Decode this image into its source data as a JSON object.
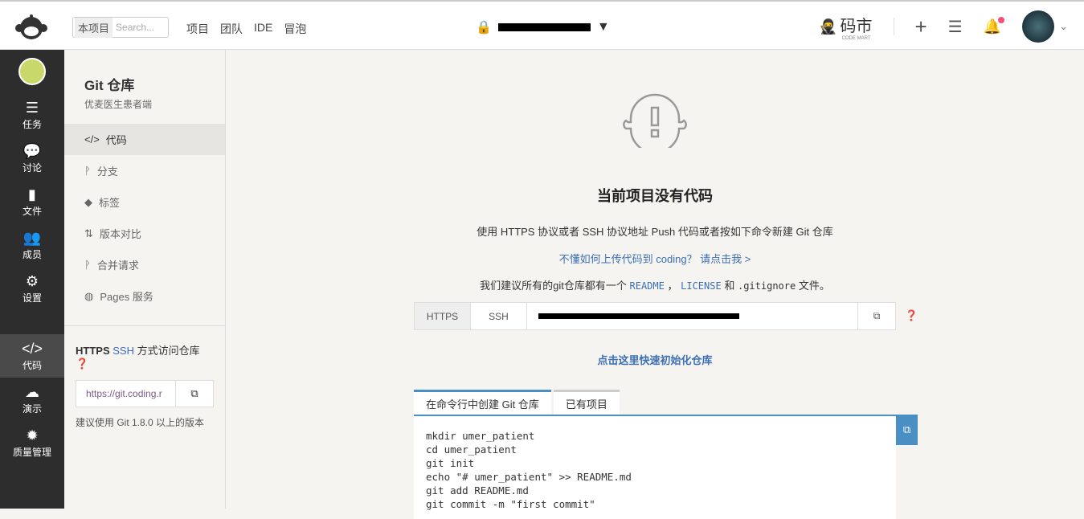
{
  "header": {
    "search_scope": "本项目",
    "search_placeholder": "Search...",
    "nav": [
      "项目",
      "团队",
      "IDE",
      "冒泡"
    ],
    "brand": "码市",
    "brand_sub": "CODE MART"
  },
  "sidebar": [
    {
      "label": "任务",
      "icon": "tasks-icon"
    },
    {
      "label": "讨论",
      "icon": "comments-icon"
    },
    {
      "label": "文件",
      "icon": "file-icon"
    },
    {
      "label": "成员",
      "icon": "users-icon"
    },
    {
      "label": "设置",
      "icon": "gear-icon"
    },
    {
      "label": "代码",
      "icon": "code-icon"
    },
    {
      "label": "演示",
      "icon": "cloud-icon"
    },
    {
      "label": "质量管理",
      "icon": "quality-icon"
    }
  ],
  "subnav": {
    "title": "Git 仓库",
    "desc": "优麦医生患者端",
    "items": [
      {
        "label": "代码",
        "icon": "</>"
      },
      {
        "label": "分支",
        "icon": "ᚹ"
      },
      {
        "label": "标签",
        "icon": "◆"
      },
      {
        "label": "版本对比",
        "icon": "⇅"
      },
      {
        "label": "合并请求",
        "icon": "ᚹ"
      },
      {
        "label": "Pages 服务",
        "icon": "◍"
      }
    ],
    "access_title_a": "HTTPS",
    "access_title_b": "SSH",
    "access_title_c": "方式访问仓库",
    "url": "https://git.coding.r",
    "hint": "建议使用 Git 1.8.0 以上的版本"
  },
  "main": {
    "title": "当前项目没有代码",
    "line1": "使用 HTTPS 协议或者 SSH 协议地址 Push 代码或者按如下命令新建 Git 仓库",
    "help_link": "不懂如何上传代码到 coding？ 请点击我 >",
    "line3a": "我们建议所有的git仓库都有一个",
    "readme": "README",
    "comma": "，",
    "license": "LICENSE",
    "and": "和",
    "gitignore": ".gitignore",
    "line3b": "文件。",
    "https": "HTTPS",
    "ssh": "SSH",
    "init_link": "点击这里快速初始化仓库",
    "tabs": [
      "在命令行中创建 Git 仓库",
      "已有项目"
    ],
    "commands": "mkdir umer_patient\ncd umer_patient\ngit init\necho \"# umer_patient\" >> README.md\ngit add README.md\ngit commit -m \"first commit\""
  }
}
